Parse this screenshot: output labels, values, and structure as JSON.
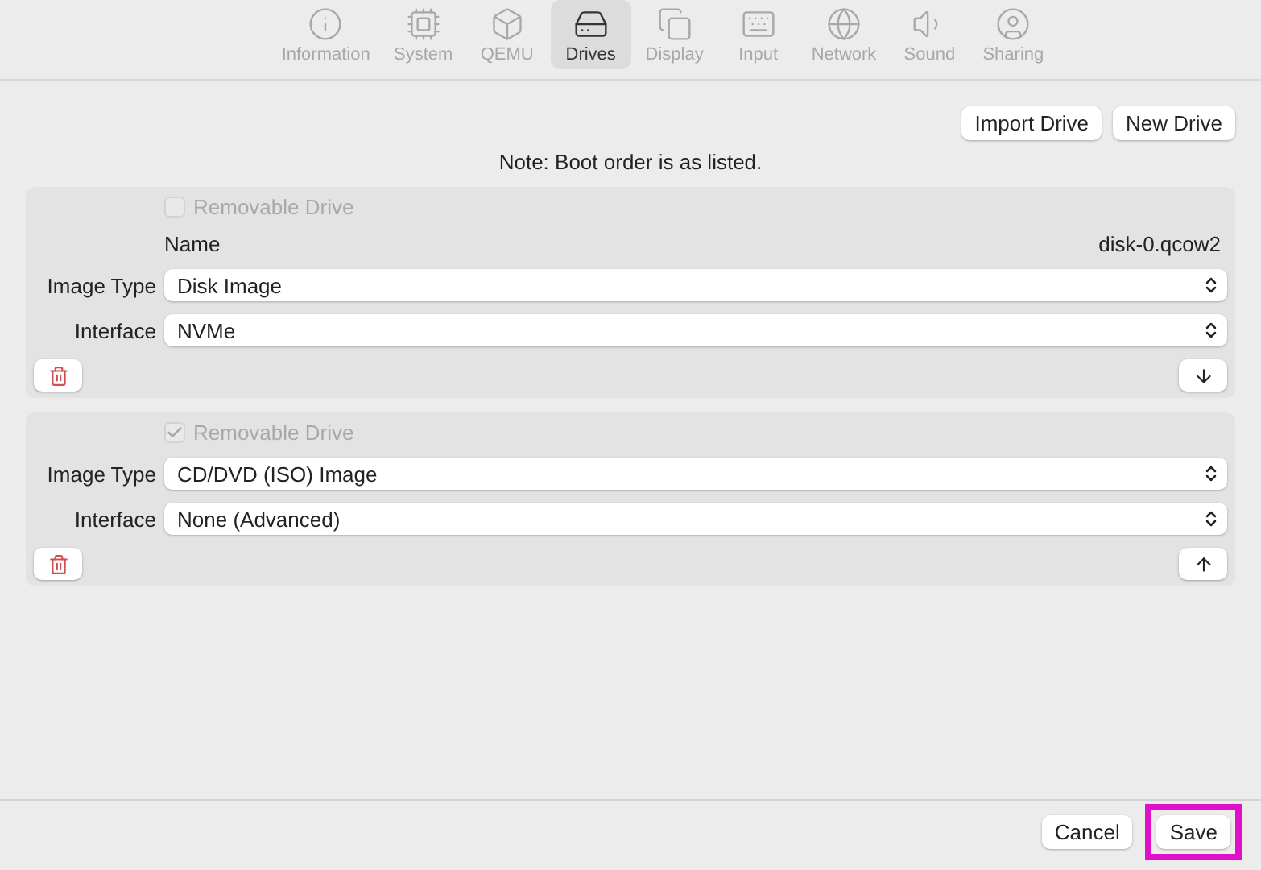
{
  "toolbar": {
    "tabs": [
      {
        "label": "Information",
        "kind": "info",
        "selected": false
      },
      {
        "label": "System",
        "kind": "cpu",
        "selected": false
      },
      {
        "label": "QEMU",
        "kind": "box",
        "selected": false
      },
      {
        "label": "Drives",
        "kind": "drive",
        "selected": true
      },
      {
        "label": "Display",
        "kind": "display",
        "selected": false
      },
      {
        "label": "Input",
        "kind": "keyboard",
        "selected": false
      },
      {
        "label": "Network",
        "kind": "globe",
        "selected": false
      },
      {
        "label": "Sound",
        "kind": "sound",
        "selected": false
      },
      {
        "label": "Sharing",
        "kind": "user",
        "selected": false
      }
    ]
  },
  "actions": [
    "Import Drive",
    "New Drive"
  ],
  "note": "Note: Boot order is as listed.",
  "drives": [
    {
      "removable": {
        "label": "Removable Drive",
        "checked": false,
        "disabled": true
      },
      "name": {
        "label": "Name",
        "value": "disk-0.qcow2"
      },
      "image_type": {
        "label": "Image Type",
        "value": "Disk Image"
      },
      "interface": {
        "label": "Interface",
        "value": "NVMe"
      },
      "move_button": {
        "kind": "down"
      }
    },
    {
      "removable": {
        "label": "Removable Drive",
        "checked": true,
        "disabled": true
      },
      "image_type": {
        "label": "Image Type",
        "value": "CD/DVD (ISO) Image"
      },
      "interface": {
        "label": "Interface",
        "value": "None (Advanced)"
      },
      "move_button": {
        "kind": "up"
      }
    }
  ],
  "footer": {
    "buttons": [
      {
        "label": "Cancel",
        "highlighted": false
      },
      {
        "label": "Save",
        "highlighted": true
      }
    ]
  }
}
